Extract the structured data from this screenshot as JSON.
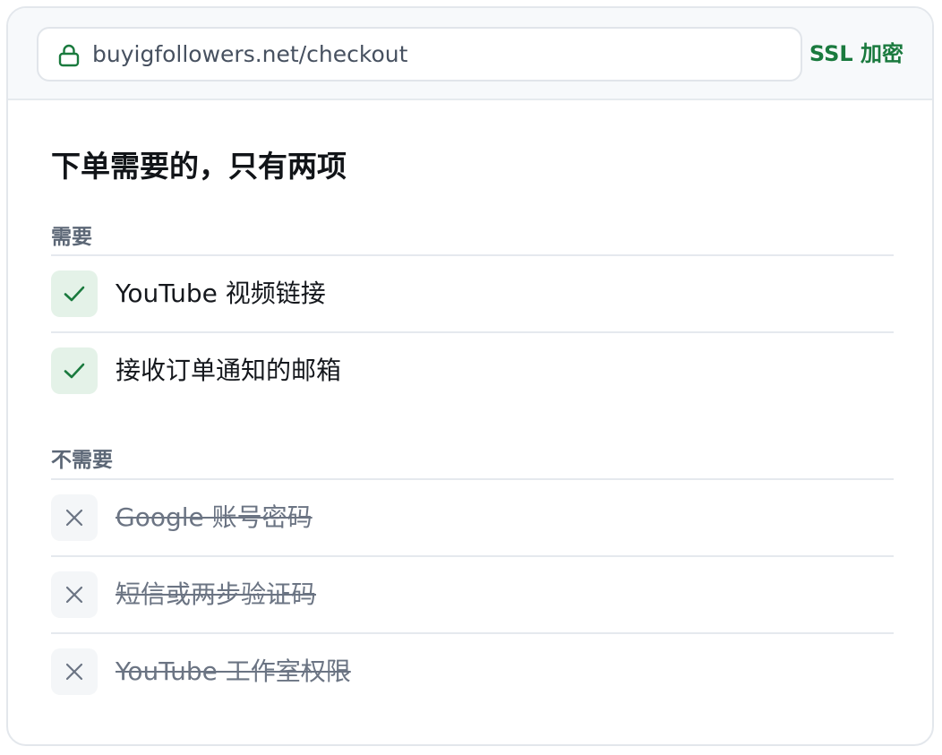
{
  "browser": {
    "url": "buyigfollowers.net/checkout",
    "ssl_label": "SSL 加密"
  },
  "title": "下单需要的，只有两项",
  "required": {
    "heading": "需要",
    "items": [
      {
        "label": "YouTube 视频链接"
      },
      {
        "label": "接收订单通知的邮箱"
      }
    ]
  },
  "not_required": {
    "heading": "不需要",
    "items": [
      {
        "label": "Google 账号密码"
      },
      {
        "label": "短信或两步验证码"
      },
      {
        "label": "YouTube 工作室权限"
      }
    ]
  },
  "colors": {
    "accent_green": "#1a7a3e",
    "check_bg": "#e4f2e8",
    "muted": "#6b7483"
  }
}
